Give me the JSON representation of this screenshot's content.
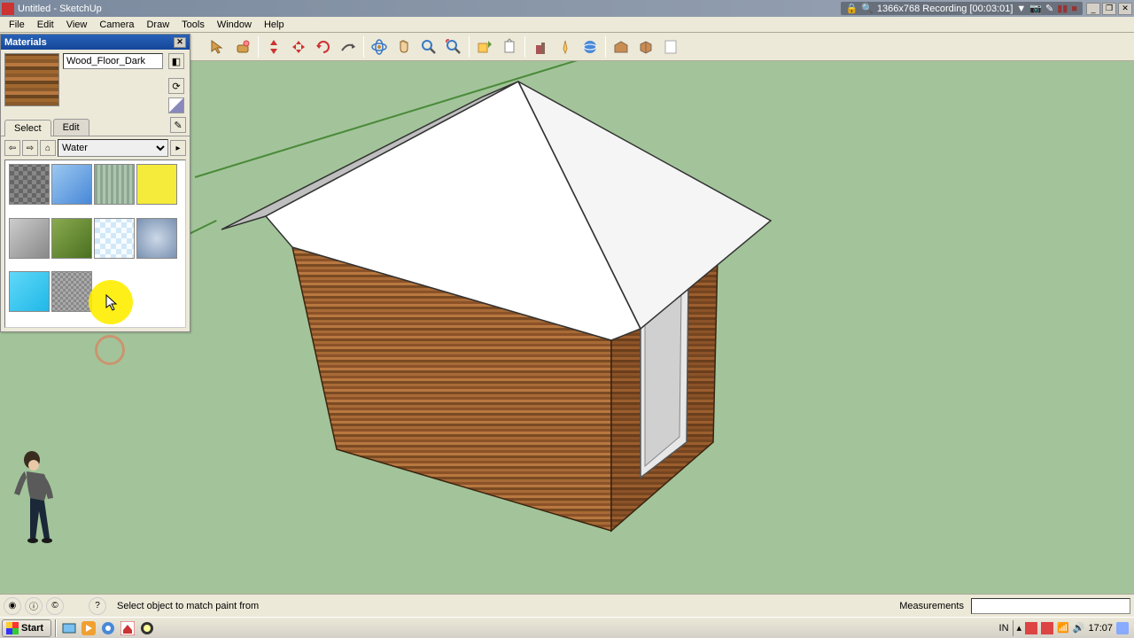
{
  "window": {
    "title": "Untitled - SketchUp",
    "recording": "1366x768  Recording [00:03:01]"
  },
  "menus": [
    "File",
    "Edit",
    "View",
    "Camera",
    "Draw",
    "Tools",
    "Window",
    "Help"
  ],
  "materials": {
    "panel_title": "Materials",
    "current_name": "Wood_Floor_Dark",
    "tabs": {
      "select": "Select",
      "edit": "Edit"
    },
    "library": "Water"
  },
  "status": {
    "hint": "Select object to match paint from",
    "measure_label": "Measurements"
  },
  "taskbar": {
    "start": "Start",
    "lang": "IN",
    "clock": "17:07"
  },
  "tool_names": [
    "select",
    "eraser",
    "push-pull",
    "move",
    "rotate",
    "follow-me",
    "offset",
    "orbit",
    "pan",
    "zoom",
    "zoom-extents",
    "get-models",
    "share",
    "building-maker",
    "geo-location",
    "preview-gm",
    "extension1",
    "extension2",
    "extension3"
  ]
}
